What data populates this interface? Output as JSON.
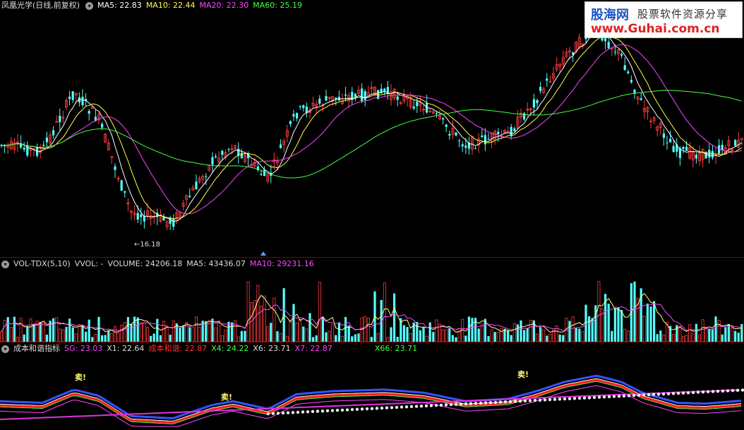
{
  "main": {
    "title": "凤凰光学(日线,前复权)",
    "ma": [
      {
        "label": "MA5: 22.83",
        "color": "#ffffff"
      },
      {
        "label": "MA10: 22.44",
        "color": "#ffff44"
      },
      {
        "label": "MA20: 22.30",
        "color": "#ff44ff"
      },
      {
        "label": "MA60: 25.19",
        "color": "#44ff44"
      }
    ],
    "min_price_label": "16.18",
    "colors": {
      "up": "#ff3c3c",
      "down": "#54ffff",
      "ma5": "#ffffff",
      "ma10": "#ffff44",
      "ma20": "#ff44ff",
      "ma60": "#44ff44"
    }
  },
  "watermark": {
    "brand": "股海网",
    "slogan": "股票软件资源分享",
    "url": "www.Guhai.com.cn"
  },
  "volume": {
    "title": "VOL-TDX(5,10)",
    "items": [
      {
        "label": "VVOL: -",
        "color": "#dddddd"
      },
      {
        "label": "VOLUME: 24206.18",
        "color": "#dddddd"
      },
      {
        "label": "MA5: 43436.07",
        "color": "#dddddd"
      },
      {
        "label": "MA10: 29231.16",
        "color": "#ff44ff"
      }
    ]
  },
  "indicator": {
    "title": "成本和谐指标",
    "items": [
      {
        "label": "SG: 23.03",
        "color": "#ff44ff"
      },
      {
        "label": "X1: 22.64",
        "color": "#dddddd"
      },
      {
        "label": "成本和谐: 22.87",
        "color": "#ff3030"
      },
      {
        "label": "X4: 24.22",
        "color": "#44ff44"
      },
      {
        "label": "X6: 23.71",
        "color": "#dddddd"
      },
      {
        "label": "X7: 22.87",
        "color": "#ff44ff"
      },
      {
        "label": "X66: 23.71",
        "color": "#44ff44"
      }
    ],
    "sell_label": "卖!"
  }
}
